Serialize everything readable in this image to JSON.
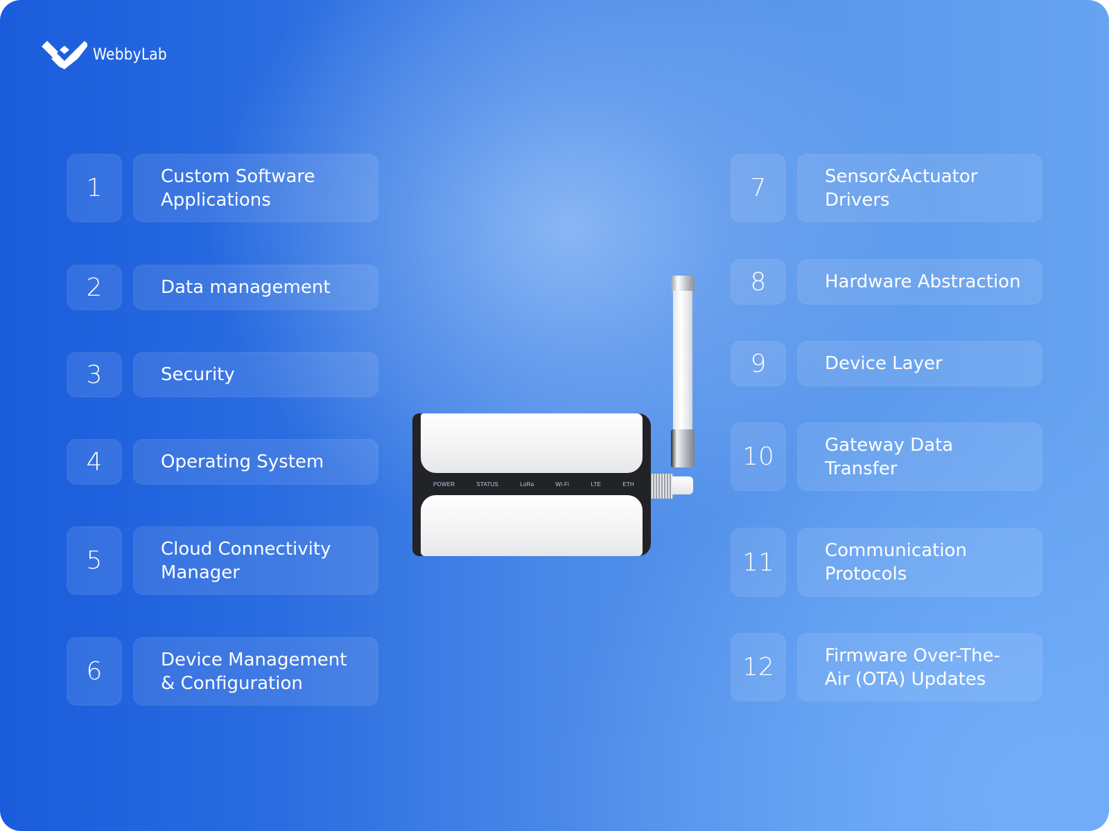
{
  "brand": {
    "name": "WebbyLab",
    "logo_icon": "webbylab-w-logo-icon"
  },
  "left_items": [
    {
      "number": "1",
      "label": "Custom Software\nApplications"
    },
    {
      "number": "2",
      "label": "Data management"
    },
    {
      "number": "3",
      "label": "Security"
    },
    {
      "number": "4",
      "label": "Operating System"
    },
    {
      "number": "5",
      "label": "Cloud Connectivity\nManager"
    },
    {
      "number": "6",
      "label": "Device Management\n& Configuration"
    }
  ],
  "right_items": [
    {
      "number": "7",
      "label": "Sensor&Actuator\nDrivers"
    },
    {
      "number": "8",
      "label": "Hardware Abstraction"
    },
    {
      "number": "9",
      "label": "Device Layer"
    },
    {
      "number": "10",
      "label": "Gateway Data\nTransfer"
    },
    {
      "number": "11",
      "label": "Communication\nProtocols"
    },
    {
      "number": "12",
      "label": "Firmware Over-The-\nAir (OTA) Updates"
    }
  ],
  "device": {
    "image": "iot-gateway-device-with-antenna",
    "indicators": [
      "POWER",
      "STATUS",
      "LoRa",
      "Wi-Fi",
      "LTE",
      "ETH"
    ]
  },
  "colors": {
    "background_left": "#1a5cdb",
    "background_right": "#66a3f0",
    "glow_center": "#80adf0",
    "text": "#ffffff"
  }
}
